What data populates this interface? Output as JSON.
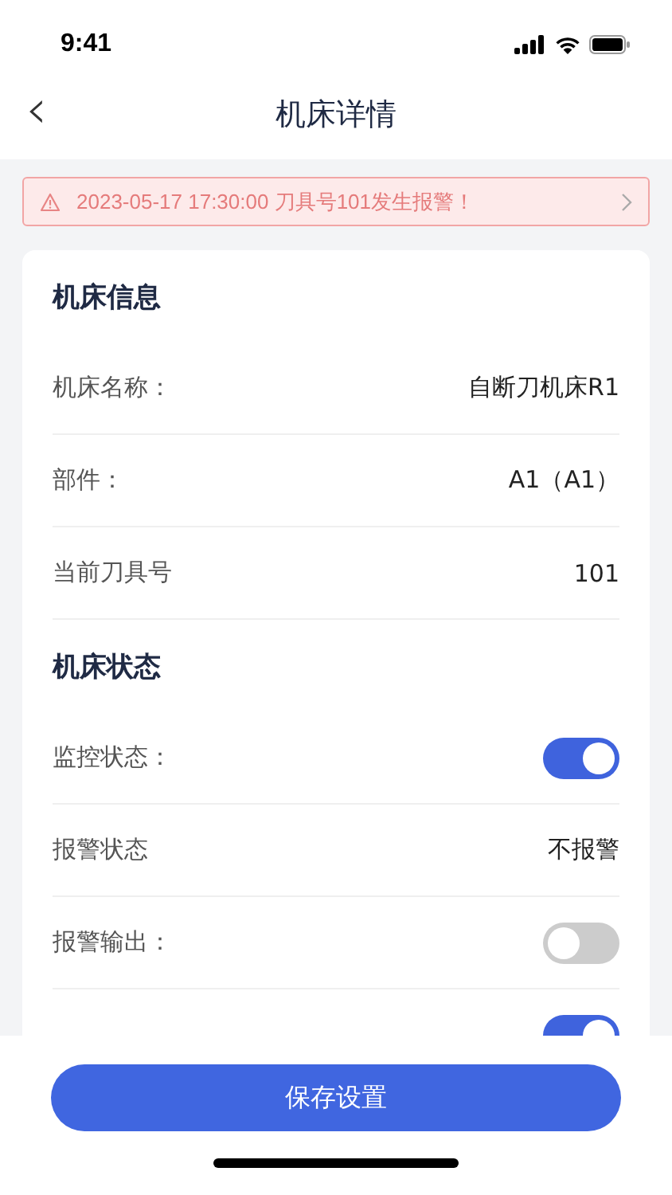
{
  "status_bar": {
    "time": "9:41"
  },
  "nav": {
    "back": "‹",
    "title": "机床详情"
  },
  "alert": {
    "text": "2023-05-17 17:30:00 刀具号101发生报警！"
  },
  "sections": [
    {
      "title": "机床信息",
      "rows": [
        {
          "kind": "text",
          "label": "机床名称：",
          "value": "自断刀机床R1"
        },
        {
          "kind": "text",
          "label": "部件：",
          "value": "A1（A1）"
        },
        {
          "kind": "text",
          "label": "当前刀具号",
          "value": "101"
        }
      ]
    },
    {
      "title": "机床状态",
      "rows": [
        {
          "kind": "toggle",
          "label": "监控状态：",
          "on": true
        },
        {
          "kind": "text",
          "label": "报警状态",
          "value": "不报警"
        },
        {
          "kind": "toggle",
          "label": "报警输出：",
          "on": false
        },
        {
          "kind": "toggle",
          "on": true
        }
      ]
    }
  ],
  "save_button": "保存设置"
}
